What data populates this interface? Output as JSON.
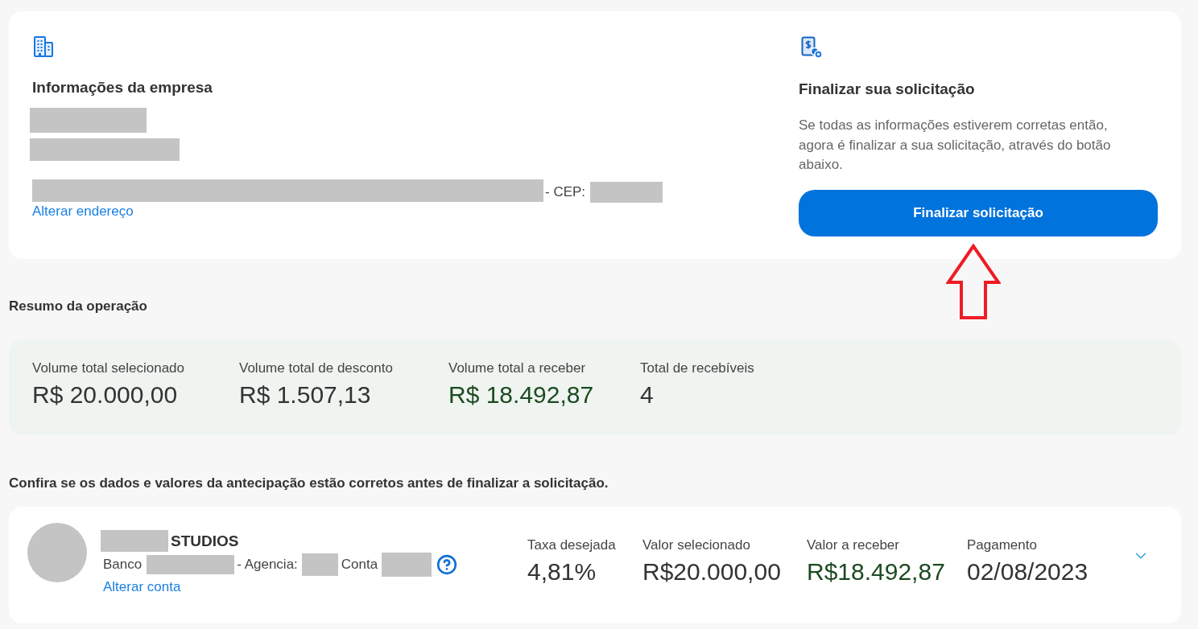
{
  "company_info": {
    "title": "Informações da empresa",
    "cep_label": "- CEP:",
    "change_address_link": "Alterar endereço"
  },
  "finalize": {
    "title": "Finalizar sua solicitação",
    "description": "Se todas as informações estiverem corretas então, agora é finalizar a sua solicitação, através do botão abaixo.",
    "button": "Finalizar solicitação"
  },
  "summary": {
    "title": "Resumo da operação",
    "metrics": [
      {
        "label": "Volume total selecionado",
        "value": "R$ 20.000,00",
        "color": "#333333"
      },
      {
        "label": "Volume total de desconto",
        "value": "R$ 1.507,13",
        "color": "#333333"
      },
      {
        "label": "Volume total a receber",
        "value": "R$ 18.492,87",
        "color": "#1d4a22"
      },
      {
        "label": "Total de recebíveis",
        "value": "4",
        "color": "#333333"
      }
    ]
  },
  "confirm_note": "Confira se os dados e valores da antecipação estão corretos antes de finalizar a solicitação.",
  "receivables": [
    {
      "name_suffix": "STUDIOS",
      "bank_label": "Banco",
      "agency_label": "- Agencia:",
      "account_label": "Conta",
      "change_account_link": "Alterar conta",
      "expanded": false,
      "fields": [
        {
          "label": "Taxa desejada",
          "value": "4,81%",
          "color": "#333333"
        },
        {
          "label": "Valor selecionado",
          "value": "R$20.000,00",
          "color": "#333333"
        },
        {
          "label": "Valor a receber",
          "value": "R$18.492,87",
          "color": "#1d4a22"
        },
        {
          "label": "Pagamento",
          "value": "02/08/2023",
          "color": "#333333"
        }
      ]
    }
  ]
}
